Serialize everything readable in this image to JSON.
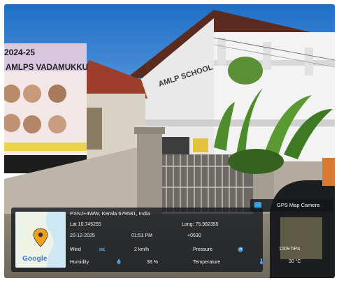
{
  "banner": {
    "year": "2024-25",
    "school_name": "AMLPS VADAMUKKU"
  },
  "building": {
    "sign_text": "AMLP SCHOOL"
  },
  "gps_app": {
    "title": "GPS Map Camera"
  },
  "map": {
    "provider": "Google"
  },
  "location": {
    "address": "PXNJ+4WW, Kerala 679581, India",
    "lat": "Lat 10.745255",
    "long": "Long: 75.982355",
    "date": "20-12-2025",
    "time": "01:51 PM",
    "timezone": "+0530"
  },
  "weather": {
    "wind_label": "Wind",
    "wind_value": "2 km/h",
    "pressure_label": "Pressure",
    "pressure_value": "1009 hPa",
    "humidity_label": "Humidity",
    "humidity_value": "38 %",
    "temperature_label": "Temperature",
    "temperature_value": "30 °C"
  },
  "colors": {
    "sky": "#2f7fd1",
    "building_wall": "#efefef",
    "roof_tile": "#9b3f2c",
    "overlay_bg": "#12161c",
    "map_pin": "#f0a11a"
  },
  "icons": {
    "wind": "wind-icon",
    "pressure": "pressure-icon",
    "humidity": "humidity-icon",
    "temperature": "thermometer-icon",
    "pin": "map-pin-icon",
    "app": "gps-camera-logo-icon"
  }
}
